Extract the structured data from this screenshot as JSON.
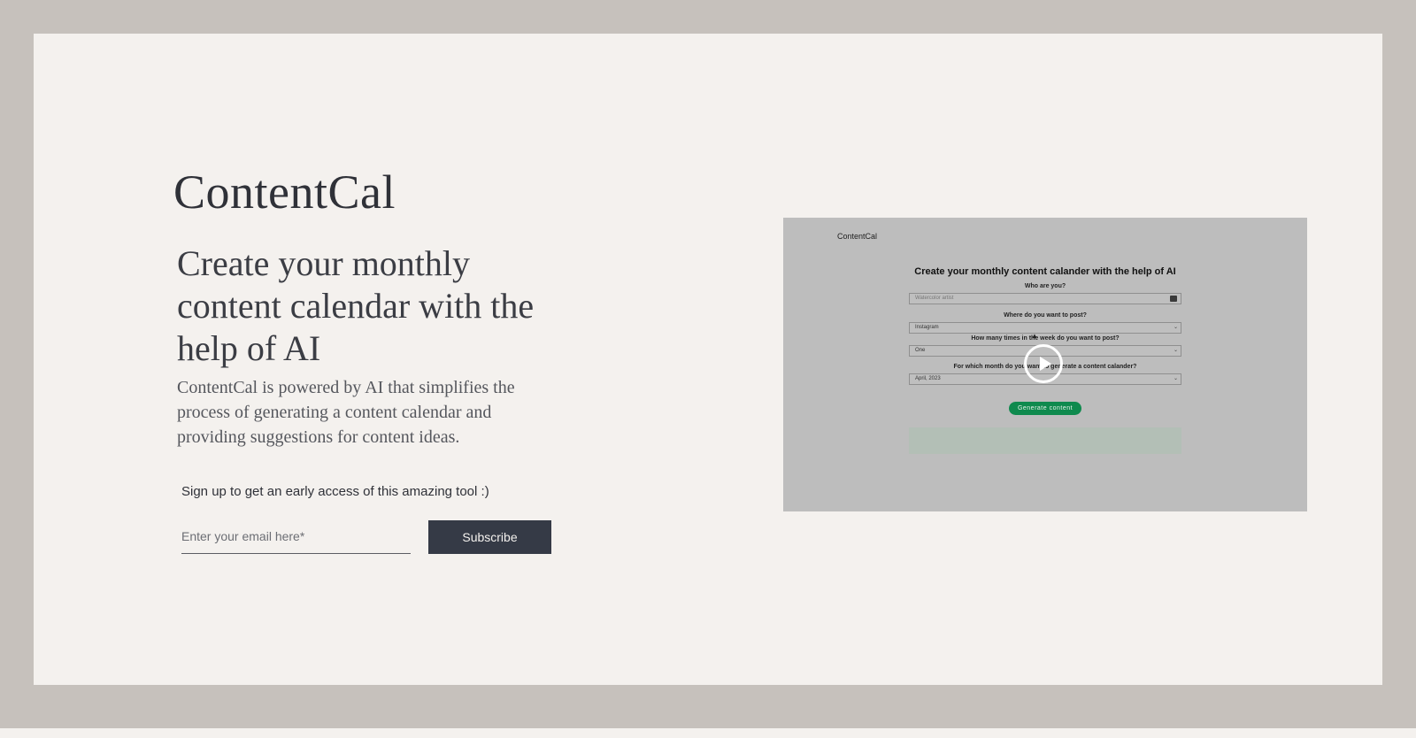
{
  "hero": {
    "brand": "ContentCal",
    "headline": "Create your monthly content calendar with the help of AI",
    "description": "ContentCal is powered by AI that simplifies the process of generating a content calendar and providing suggestions for content ideas."
  },
  "signup": {
    "prompt": "Sign up to get an early access of this amazing tool :)",
    "email_placeholder": "Enter your email here*",
    "subscribe_label": "Subscribe"
  },
  "video": {
    "brand": "ContentCal",
    "title": "Create your monthly content calander with the help of AI",
    "q1_label": "Who are you?",
    "q1_value": "Watercolor artist",
    "q2_label": "Where do you want to post?",
    "q2_value": "Instagram",
    "q3_label": "How many times in the week do you want to post?",
    "q3_value": "One",
    "q4_label": "For which month do you want to generate a content calander?",
    "q4_value": "April, 2023",
    "generate_label": "Generate content"
  },
  "icons": {
    "play": "play-icon",
    "calendar": "calendar-icon",
    "chevron": "chevron-down-icon"
  }
}
